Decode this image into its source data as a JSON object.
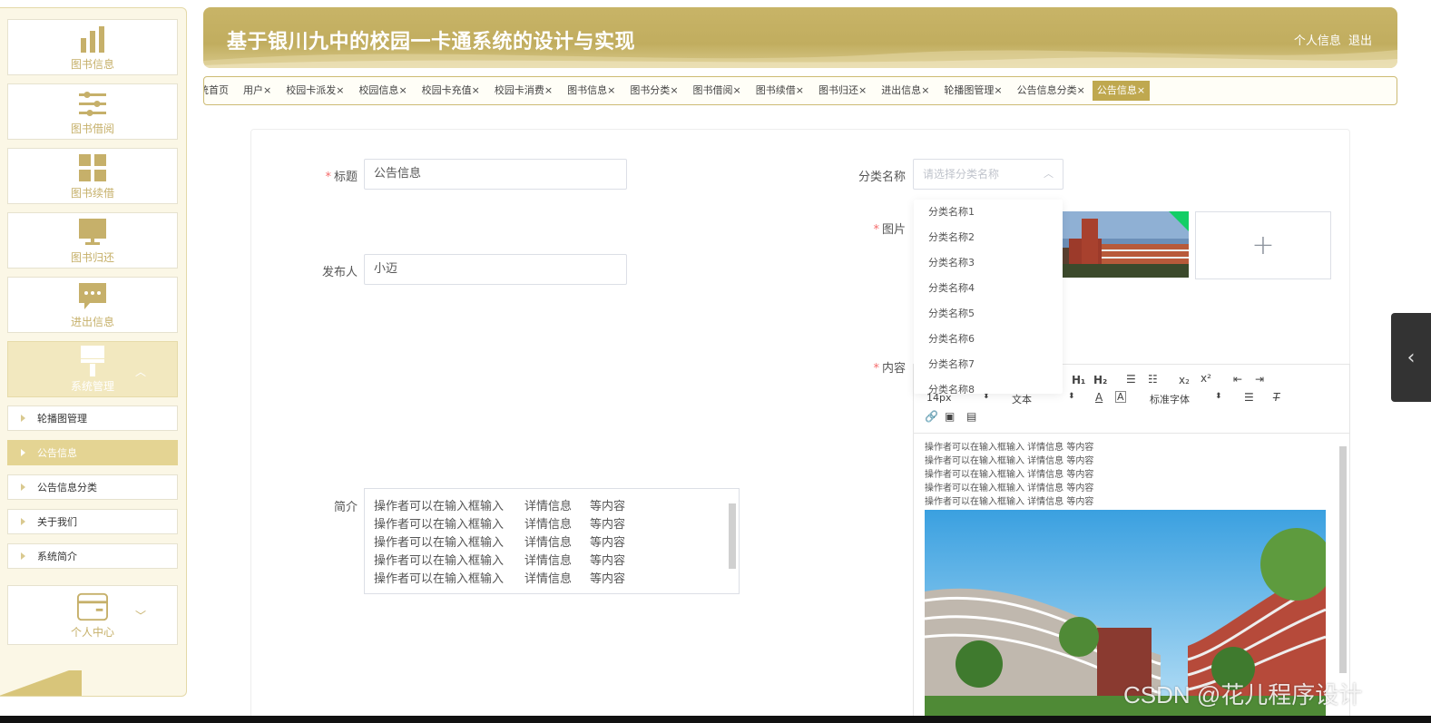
{
  "header": {
    "title": "基于银川九中的校园一卡通系统的设计与实现",
    "profile_label": "个人信息",
    "logout_label": "退出"
  },
  "sidebar": {
    "cards": [
      {
        "label": "图书信息",
        "icon": "bar-chart-icon"
      },
      {
        "label": "图书借阅",
        "icon": "sliders-icon"
      },
      {
        "label": "图书续借",
        "icon": "grid-icon"
      },
      {
        "label": "图书归还",
        "icon": "monitor-icon"
      },
      {
        "label": "进出信息",
        "icon": "chat-bubble-icon"
      },
      {
        "label": "系统管理",
        "icon": "brush-icon"
      }
    ],
    "sub_items": [
      {
        "label": "轮播图管理"
      },
      {
        "label": "公告信息"
      },
      {
        "label": "公告信息分类"
      },
      {
        "label": "关于我们"
      },
      {
        "label": "系统简介"
      }
    ],
    "bottom_card": {
      "label": "个人中心",
      "icon": "wallet-icon"
    }
  },
  "tabs": [
    {
      "label": "统首页"
    },
    {
      "label": "用户"
    },
    {
      "label": "校园卡派发"
    },
    {
      "label": "校园信息"
    },
    {
      "label": "校园卡充值"
    },
    {
      "label": "校园卡消费"
    },
    {
      "label": "图书信息"
    },
    {
      "label": "图书分类"
    },
    {
      "label": "图书借阅"
    },
    {
      "label": "图书续借"
    },
    {
      "label": "图书归还"
    },
    {
      "label": "进出信息"
    },
    {
      "label": "轮播图管理"
    },
    {
      "label": "公告信息分类"
    },
    {
      "label": "公告信息"
    }
  ],
  "tab_close": "×",
  "form": {
    "required_mark": "*",
    "title_label": "标题",
    "title_value": "公告信息",
    "category_label": "分类名称",
    "category_placeholder": "请选择分类名称",
    "image_label": "图片",
    "publisher_label": "发布人",
    "publisher_value": "小迈",
    "content_label": "内容",
    "summary_label": "简介",
    "summary_rows": [
      {
        "a": "操作者可以在输入框输入",
        "b": "详情信息",
        "c": "等内容"
      },
      {
        "a": "操作者可以在输入框输入",
        "b": "详情信息",
        "c": "等内容"
      },
      {
        "a": "操作者可以在输入框输入",
        "b": "详情信息",
        "c": "等内容"
      },
      {
        "a": "操作者可以在输入框输入",
        "b": "详情信息",
        "c": "等内容"
      },
      {
        "a": "操作者可以在输入框输入",
        "b": "详情信息",
        "c": "等内容"
      }
    ],
    "upload_plus": "+"
  },
  "dropdown": {
    "options": [
      "分类名称1",
      "分类名称2",
      "分类名称3",
      "分类名称4",
      "分类名称5",
      "分类名称6",
      "分类名称7",
      "分类名称8"
    ]
  },
  "editor": {
    "toolbar": {
      "h1": "H₁",
      "h2": "H₂",
      "font_size": "14px",
      "text_style": "文本",
      "font_family": "标准字体",
      "subscript": "x₂",
      "superscript": "x²"
    },
    "content_lines": [
      "操作者可以在输入框输入  详情信息  等内容",
      "操作者可以在输入框输入  详情信息  等内容",
      "操作者可以在输入框输入  详情信息  等内容",
      "操作者可以在输入框输入  详情信息  等内容",
      "操作者可以在输入框输入  详情信息  等内容"
    ]
  },
  "watermark": "CSDN @花儿程序设计",
  "colors": {
    "brand": "#c4b063",
    "active_tab": "#bfa84f",
    "required": "#f56c6c"
  }
}
